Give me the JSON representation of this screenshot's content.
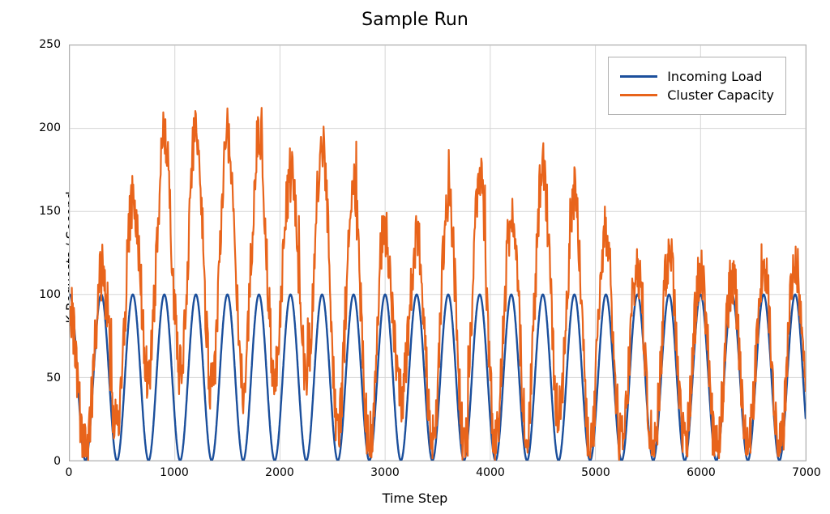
{
  "chart_data": {
    "type": "line",
    "title": "Sample Run",
    "xlabel": "Time Step",
    "ylabel": "K Requests / Second",
    "xlim": [
      0,
      7000
    ],
    "ylim": [
      0,
      250
    ],
    "xticks": [
      0,
      1000,
      2000,
      3000,
      4000,
      5000,
      6000,
      7000
    ],
    "yticks": [
      0,
      50,
      100,
      150,
      200,
      250
    ],
    "legend": {
      "position": "top-right",
      "entries": [
        "Incoming Load",
        "Cluster Capacity"
      ]
    },
    "series": [
      {
        "name": "Incoming Load",
        "color": "#1b4f9c",
        "generator": {
          "kind": "sinusoid",
          "formula": "y = offset + amplitude * sin(2*pi*x/period + phase)",
          "offset": 50,
          "amplitude": 50,
          "period": 300,
          "phase": 1.5708,
          "x_start": 0,
          "x_end": 7000,
          "dx": 2,
          "note": "Smooth periodic load oscillating 0–100, ~23 full cycles across 0–7000."
        }
      },
      {
        "name": "Cluster Capacity",
        "color": "#e8641b",
        "generator": {
          "kind": "tracking_with_noise_and_overshoot",
          "base_series": "Incoming Load",
          "early_overshoot_range": [
            0,
            2700
          ],
          "early_overshoot_peak": 200,
          "mid_overshoot_range": [
            2700,
            5000
          ],
          "mid_overshoot_peak": 175,
          "late_track_range": [
            5000,
            7000
          ],
          "late_track_peak": 125,
          "noise_amplitude": 18,
          "settles_toward_base": true,
          "note": "Noisy capacity signal; large overshoot peaks (~150–200) during early timesteps, shrinking bursts mid run, near-tracking of the sinusoid by the final third."
        },
        "approx_envelope_peaks": [
          {
            "x": 160,
            "y": 90
          },
          {
            "x": 520,
            "y": 150
          },
          {
            "x": 640,
            "y": 160
          },
          {
            "x": 780,
            "y": 197
          },
          {
            "x": 1000,
            "y": 190
          },
          {
            "x": 1150,
            "y": 200
          },
          {
            "x": 1500,
            "y": 198
          },
          {
            "x": 1800,
            "y": 196
          },
          {
            "x": 2060,
            "y": 170
          },
          {
            "x": 2460,
            "y": 190
          },
          {
            "x": 2600,
            "y": 174
          },
          {
            "x": 3200,
            "y": 122
          },
          {
            "x": 3780,
            "y": 180
          },
          {
            "x": 4200,
            "y": 144
          },
          {
            "x": 4450,
            "y": 176
          },
          {
            "x": 4720,
            "y": 168
          },
          {
            "x": 5200,
            "y": 127
          },
          {
            "x": 5450,
            "y": 116
          },
          {
            "x": 5750,
            "y": 124
          },
          {
            "x": 6000,
            "y": 112
          },
          {
            "x": 6280,
            "y": 110
          },
          {
            "x": 6600,
            "y": 120
          },
          {
            "x": 6960,
            "y": 118
          }
        ],
        "approx_envelope_troughs": [
          {
            "x": 120,
            "y": 4
          },
          {
            "x": 260,
            "y": 6
          },
          {
            "x": 420,
            "y": 15
          },
          {
            "x": 720,
            "y": 50
          },
          {
            "x": 1050,
            "y": 55
          },
          {
            "x": 1350,
            "y": 40
          },
          {
            "x": 1650,
            "y": 45
          },
          {
            "x": 1950,
            "y": 55
          },
          {
            "x": 2300,
            "y": 55
          },
          {
            "x": 2620,
            "y": 10
          },
          {
            "x": 2900,
            "y": 10
          },
          {
            "x": 3100,
            "y": 45
          },
          {
            "x": 3500,
            "y": 10
          },
          {
            "x": 3900,
            "y": 12
          },
          {
            "x": 4160,
            "y": 8
          },
          {
            "x": 4560,
            "y": 35
          },
          {
            "x": 4880,
            "y": 8
          },
          {
            "x": 5080,
            "y": 10
          },
          {
            "x": 5380,
            "y": 10
          },
          {
            "x": 5680,
            "y": 6
          },
          {
            "x": 5960,
            "y": 10
          },
          {
            "x": 6260,
            "y": 4
          },
          {
            "x": 6560,
            "y": 6
          },
          {
            "x": 6860,
            "y": 4
          }
        ]
      }
    ]
  }
}
